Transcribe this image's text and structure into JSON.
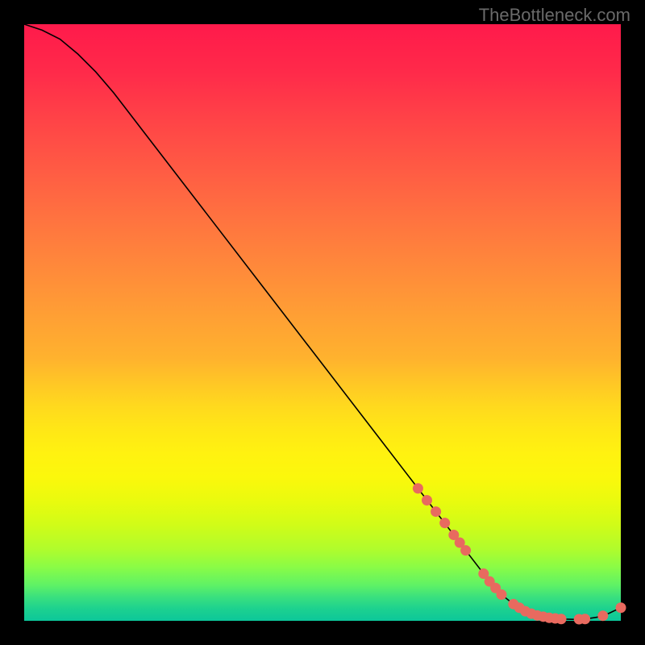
{
  "watermark": "TheBottleneck.com",
  "chart_data": {
    "type": "line",
    "title": "",
    "xlabel": "",
    "ylabel": "",
    "xlim": [
      0,
      100
    ],
    "ylim": [
      0,
      100
    ],
    "curve": {
      "x": [
        0,
        3,
        6,
        9,
        12,
        15,
        20,
        30,
        40,
        50,
        60,
        66,
        70,
        74,
        78,
        80,
        82,
        84,
        86,
        88,
        90,
        92,
        94,
        96,
        98,
        100
      ],
      "y": [
        100,
        99,
        97.5,
        95,
        92,
        88.5,
        82,
        69,
        56,
        43,
        30,
        22.2,
        17,
        11.8,
        6.6,
        4.4,
        2.8,
        1.6,
        0.9,
        0.5,
        0.3,
        0.25,
        0.3,
        0.6,
        1.25,
        2.2
      ]
    },
    "markers": {
      "x": [
        66,
        67.5,
        69,
        70.5,
        72,
        73,
        74,
        77,
        78,
        79,
        80,
        82,
        83,
        84,
        85,
        86,
        87,
        88,
        89,
        90,
        93,
        94,
        97,
        100
      ],
      "y": [
        22.2,
        20.2,
        18.3,
        16.4,
        14.4,
        13.1,
        11.8,
        7.9,
        6.6,
        5.5,
        4.4,
        2.8,
        2.2,
        1.6,
        1.2,
        0.9,
        0.7,
        0.5,
        0.4,
        0.3,
        0.27,
        0.3,
        0.85,
        2.2
      ]
    }
  }
}
